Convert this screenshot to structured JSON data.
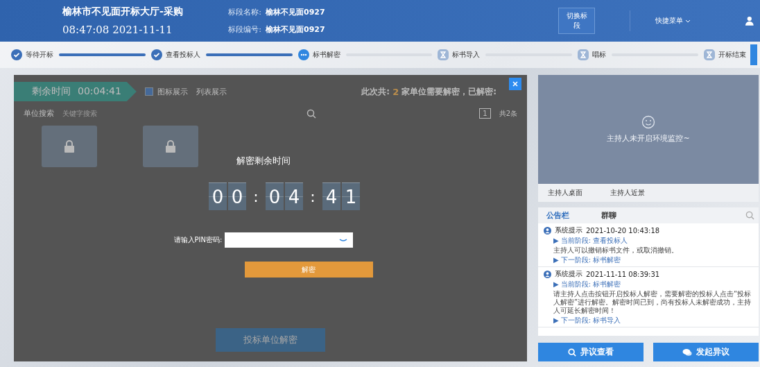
{
  "header": {
    "hall_title": "榆林市不见面开标大厅-采购",
    "clock": "08:47:08 2021-11-11",
    "section_name_label": "标段名称:",
    "section_name": "榆林不见面0927",
    "section_code_label": "标段编号:",
    "section_code": "榆林不见面0927",
    "switch_button": "切换标段",
    "quick_menu": "快捷菜单"
  },
  "steps": [
    {
      "label": "等待开标",
      "kind": "done"
    },
    {
      "label": "查看投标人",
      "kind": "done"
    },
    {
      "label": "标书解密",
      "kind": "current"
    },
    {
      "label": "标书导入",
      "kind": "pending"
    },
    {
      "label": "唱标",
      "kind": "pending"
    },
    {
      "label": "开标结束",
      "kind": "pending"
    }
  ],
  "background_panel": {
    "timer_badge_label": "剩余时间",
    "timer_badge_value": "00:04:41",
    "view_options": [
      {
        "label": "图标展示",
        "checked": true
      },
      {
        "label": "列表展示",
        "checked": false
      }
    ],
    "summary_prefix": "此次共:",
    "summary_count": "2",
    "summary_suffix": "家单位需要解密，已解密:",
    "search_label": "单位搜索",
    "search_placeholder": "关键字搜索",
    "page": "1",
    "total": "共2条",
    "folders": [
      {
        "kind": "locked"
      },
      {
        "kind": "locked"
      }
    ],
    "bottom_button": "投标单位解密"
  },
  "dialog": {
    "title": "解密剩余时间",
    "digits": [
      "0",
      "0",
      "0",
      "4",
      "4",
      "1"
    ],
    "separator": ":",
    "pin_label": "请输入PIN密码:",
    "decrypt_button": "解密"
  },
  "monitor": {
    "message": "主持人未开启环境监控~",
    "tabs": [
      {
        "label": "主持人桌面",
        "selected": false
      },
      {
        "label": "主持人近景",
        "selected": false
      }
    ]
  },
  "bulletin": {
    "tabs": [
      {
        "label": "公告栏",
        "selected": true
      },
      {
        "label": "群聊",
        "selected": false
      }
    ],
    "messages": [
      {
        "sender": "系统提示",
        "time": "2021-10-20 10:43:18",
        "current_stage": "▶ 当前阶段: 查看投标人",
        "body": "主持人可以撤销标书文件，或取消撤销。",
        "next_stage": "▶ 下一阶段: 标书解密"
      },
      {
        "sender": "系统提示",
        "time": "2021-11-11 08:39:31",
        "current_stage": "▶ 当前阶段: 标书解密",
        "body": "请主持人点击按钮开启投标人解密，需要解密的投标人点击“投标人解密”进行解密。解密时间已到，尚有投标人未解密成功，主持人可延长解密时间！",
        "next_stage": "▶ 下一阶段: 标书导入"
      }
    ]
  },
  "actions": [
    {
      "label": "异议查看",
      "kind": "view"
    },
    {
      "label": "发起异议",
      "kind": "raise"
    }
  ]
}
